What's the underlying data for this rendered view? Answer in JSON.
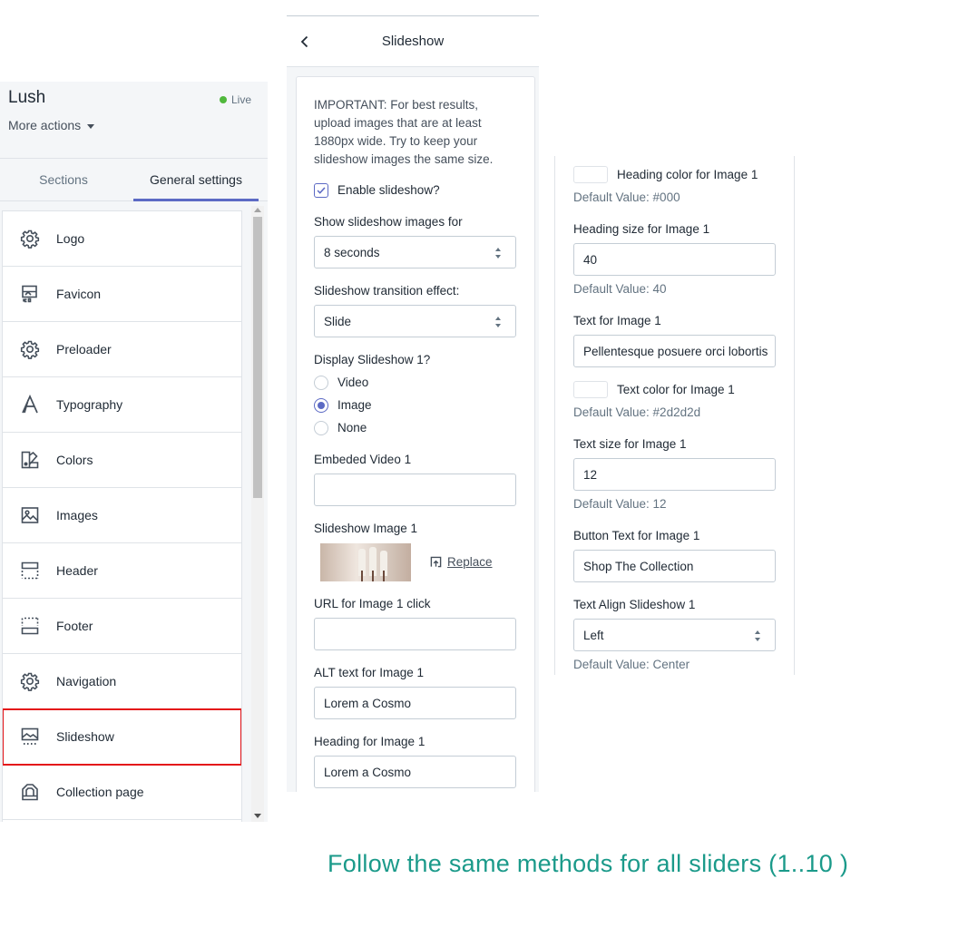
{
  "store": {
    "name": "Lush",
    "status": "Live",
    "more_actions": "More actions"
  },
  "tabs": [
    {
      "label": "Sections"
    },
    {
      "label": "General settings"
    }
  ],
  "settings_items": [
    {
      "label": "Logo",
      "icon": "gear-icon"
    },
    {
      "label": "Favicon",
      "icon": "favicon-icon"
    },
    {
      "label": "Preloader",
      "icon": "gear-icon"
    },
    {
      "label": "Typography",
      "icon": "typography-icon"
    },
    {
      "label": "Colors",
      "icon": "colors-icon"
    },
    {
      "label": "Images",
      "icon": "image-icon"
    },
    {
      "label": "Header",
      "icon": "header-icon"
    },
    {
      "label": "Footer",
      "icon": "footer-icon"
    },
    {
      "label": "Navigation",
      "icon": "gear-icon"
    },
    {
      "label": "Slideshow",
      "icon": "slideshow-icon"
    },
    {
      "label": "Collection page",
      "icon": "collection-icon"
    }
  ],
  "slideshow": {
    "title": "Slideshow",
    "important_note": "IMPORTANT: For best results, upload images that are at least 1880px wide. Try to keep your slideshow images the same size.",
    "enable_label": "Enable slideshow?",
    "show_for_label": "Show slideshow images for",
    "show_for_value": "8 seconds",
    "transition_label": "Slideshow transition effect:",
    "transition_value": "Slide",
    "display_label": "Display Slideshow 1?",
    "display_options": [
      "Video",
      "Image",
      "None"
    ],
    "embedded_video_label": "Embeded Video 1",
    "embedded_video_value": "",
    "image_label": "Slideshow Image 1",
    "replace_label": "Replace",
    "url_label": "URL for Image 1 click",
    "url_value": "",
    "alt_label": "ALT text for Image 1",
    "alt_value": "Lorem a Cosmo",
    "heading_label": "Heading for Image 1",
    "heading_value": "Lorem a Cosmo"
  },
  "image1_settings": {
    "heading_color_label": "Heading color for Image 1",
    "heading_color_default": "Default Value: #000",
    "heading_size_label": "Heading size for Image 1",
    "heading_size_value": "40",
    "heading_size_default": "Default Value: 40",
    "text_label": "Text for Image 1",
    "text_value": "Pellentesque posuere orci lobortis",
    "text_color_label": "Text color for Image 1",
    "text_color_default": "Default Value: #2d2d2d",
    "text_size_label": "Text size for Image 1",
    "text_size_value": "12",
    "text_size_default": "Default Value: 12",
    "button_text_label": "Button Text for Image 1",
    "button_text_value": "Shop The Collection",
    "text_align_label": "Text Align Slideshow 1",
    "text_align_value": "Left",
    "text_align_default": "Default Value: Center"
  },
  "footer_note": "Follow the same methods for  all sliders (1..10 )",
  "colors": {
    "accent": "#5c6ac4",
    "live": "#50b83c",
    "highlight": "#e4161a",
    "note": "#1b9a8a"
  }
}
